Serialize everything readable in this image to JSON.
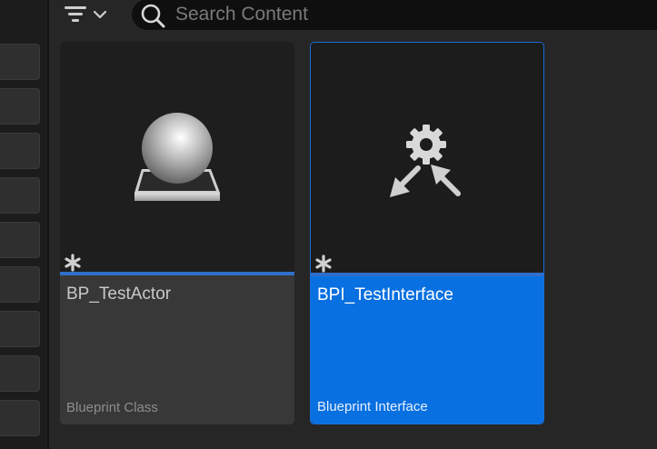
{
  "search": {
    "placeholder": "Search Content"
  },
  "assets": [
    {
      "name": "BP_TestActor",
      "type": "Blueprint Class",
      "icon": "blueprint-actor-sphere-icon"
    },
    {
      "name": "BPI_TestInterface",
      "type": "Blueprint Interface",
      "icon": "blueprint-interface-gear-icon"
    }
  ],
  "colors": {
    "background": "#262626",
    "selection": "#0870e0",
    "accent_bar": "#2f6ec9"
  }
}
